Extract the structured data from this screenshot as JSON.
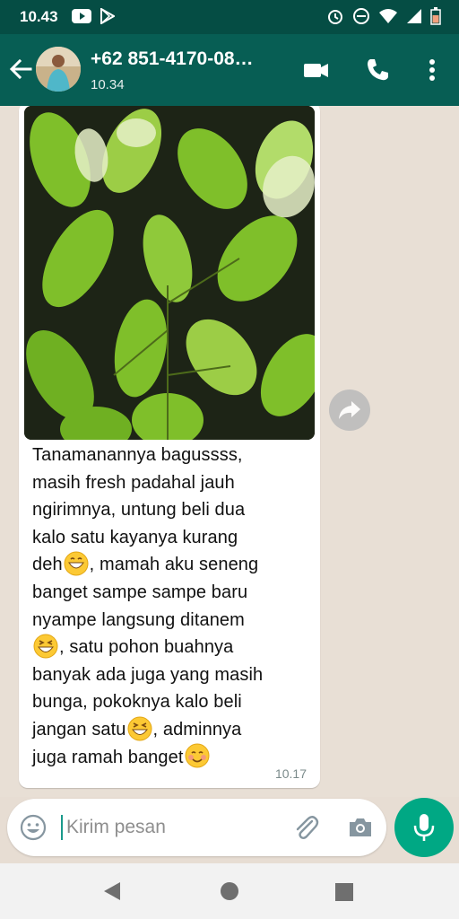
{
  "status_bar": {
    "time": "10.43",
    "icons": [
      "youtube-icon",
      "play-store-icon",
      "alarm-icon",
      "do-not-disturb-icon",
      "wifi-icon",
      "signal-icon",
      "battery-icon"
    ]
  },
  "header": {
    "contact_name": "+62 851-4170-08…",
    "last_seen": "10.34",
    "colors": {
      "header": "#075e54",
      "status_bar": "#054d44"
    }
  },
  "message": {
    "text_lines": [
      "Tanamanannya bagussss,",
      "masih fresh padahal jauh",
      "ngirimnya, untung beli dua",
      "kalo satu kayanya kurang",
      "deh",
      ", mamah aku seneng",
      "banget sampe sampe baru",
      "nyampe langsung ditanem",
      ", satu pohon buahnya",
      "banyak ada juga yang masih",
      "bunga, pokoknya kalo beli",
      "jangan satu",
      ", adminnya",
      "juga ramah banget"
    ],
    "emojis": [
      "grinning-face-icon",
      "laughing-face-icon",
      "laughing-face-icon",
      "smiling-face-icon"
    ],
    "time": "10.17"
  },
  "composer": {
    "placeholder": "Kirim pesan",
    "accent": "#00a884"
  },
  "navbar": {
    "buttons": [
      "back-triangle-icon",
      "home-circle-icon",
      "recents-square-icon"
    ]
  }
}
